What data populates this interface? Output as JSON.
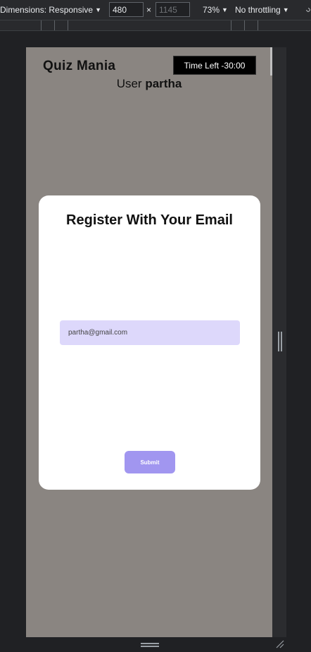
{
  "devtools": {
    "dimensions_label": "Dimensions: Responsive",
    "width_value": "480",
    "height_placeholder": "1145",
    "times_symbol": "×",
    "zoom": "73%",
    "throttling": "No throttling"
  },
  "app": {
    "title": "Quiz Mania",
    "timer_label": "Time Left -30:00",
    "user_prefix": "User",
    "user_name": "partha"
  },
  "modal": {
    "title": "Register With Your Email",
    "email_value": "partha@gmail.com",
    "submit_label": "Submit"
  },
  "colors": {
    "overlay": "#8a8581",
    "input_bg": "#ddd8fb",
    "button_bg": "#a196f0"
  }
}
